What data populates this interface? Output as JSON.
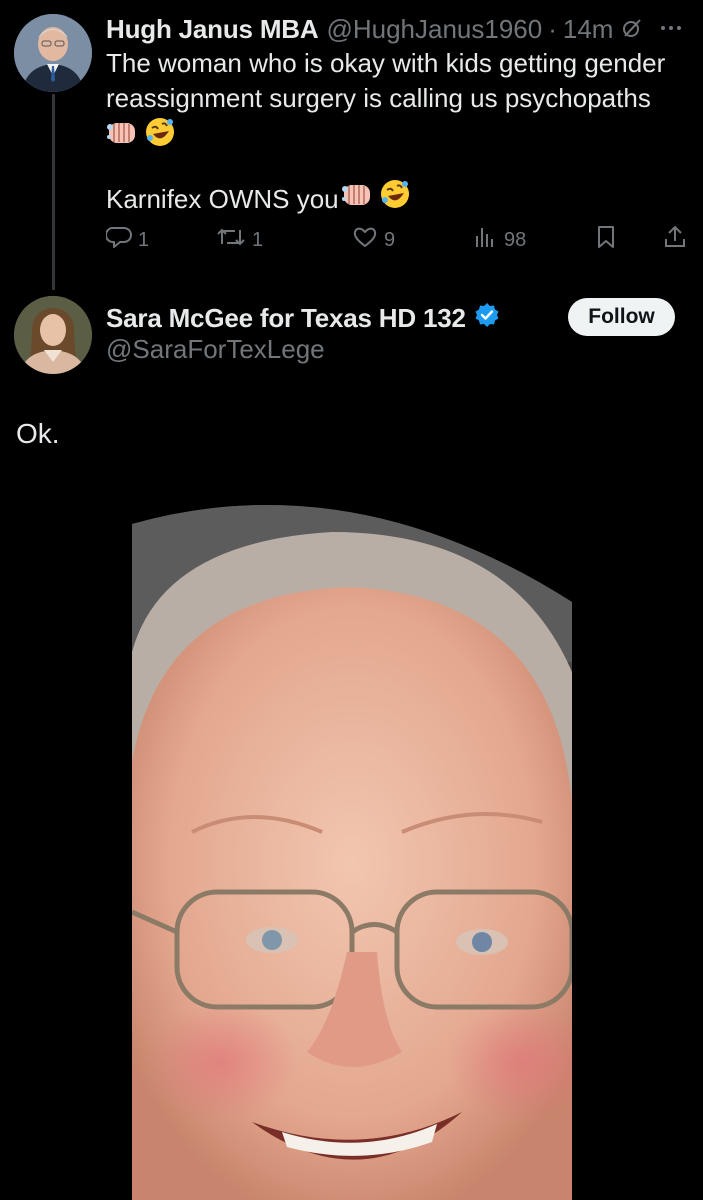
{
  "reply_tweet": {
    "author_name": "Hugh Janus MBA",
    "author_handle": "@HughJanus1960",
    "separator": "·",
    "time": "14m",
    "text_line_1": "The woman who is okay with kids getting gender",
    "text_line_2": "reassignment surgery is calling us psychopaths",
    "text_line_3": "Karnifex OWNS you",
    "emojis": [
      "oncoming-fist-emoji",
      "rolling-on-floor-laughing-emoji"
    ],
    "actions": {
      "replies": "1",
      "reposts": "1",
      "likes": "9",
      "views": "98"
    }
  },
  "main_tweet": {
    "author_name": "Sara McGee for Texas HD 132",
    "author_handle": "@SaraForTexLege",
    "verified": true,
    "follow_label": "Follow",
    "text": "Ok."
  },
  "colors": {
    "background": "#000000",
    "primary_text": "#e7e9ea",
    "secondary_text": "#71767b",
    "verified_blue": "#1d9bf0",
    "follow_button_bg": "#eff3f4"
  }
}
